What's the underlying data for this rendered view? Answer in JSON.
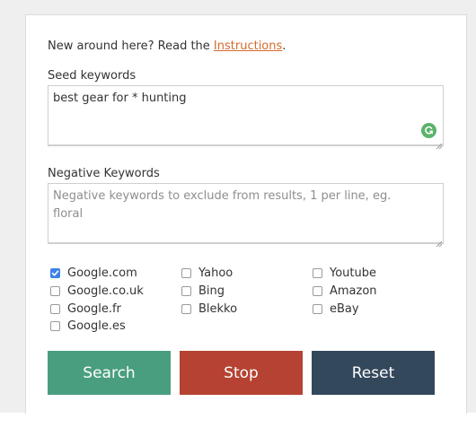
{
  "intro": {
    "prefix": "New around here? Read the ",
    "link": "Instructions",
    "suffix": "."
  },
  "seed": {
    "label": "Seed keywords",
    "value": "best gear for * hunting"
  },
  "negative": {
    "label": "Negative Keywords",
    "placeholder": "Negative keywords to exclude from results, 1 per line, eg.\nfloral"
  },
  "engines": [
    {
      "label": "Google.com",
      "checked": true
    },
    {
      "label": "Google.co.uk",
      "checked": false
    },
    {
      "label": "Google.fr",
      "checked": false
    },
    {
      "label": "Google.es",
      "checked": false
    },
    {
      "label": "Yahoo",
      "checked": false
    },
    {
      "label": "Bing",
      "checked": false
    },
    {
      "label": "Blekko",
      "checked": false
    },
    {
      "label": "Youtube",
      "checked": false
    },
    {
      "label": "Amazon",
      "checked": false
    },
    {
      "label": "eBay",
      "checked": false
    }
  ],
  "buttons": {
    "search": "Search",
    "stop": "Stop",
    "reset": "Reset"
  },
  "colors": {
    "link": "#d36a2c",
    "search_button": "#4a9e80",
    "stop_button": "#b54232",
    "reset_button": "#34485c",
    "checkbox_checked": "#3d82e6",
    "grammar_icon": "#5bb36b"
  },
  "icons": {
    "grammar": "grammar-check-icon",
    "resize": "resize-grip-icon",
    "check": "checkmark-icon"
  }
}
